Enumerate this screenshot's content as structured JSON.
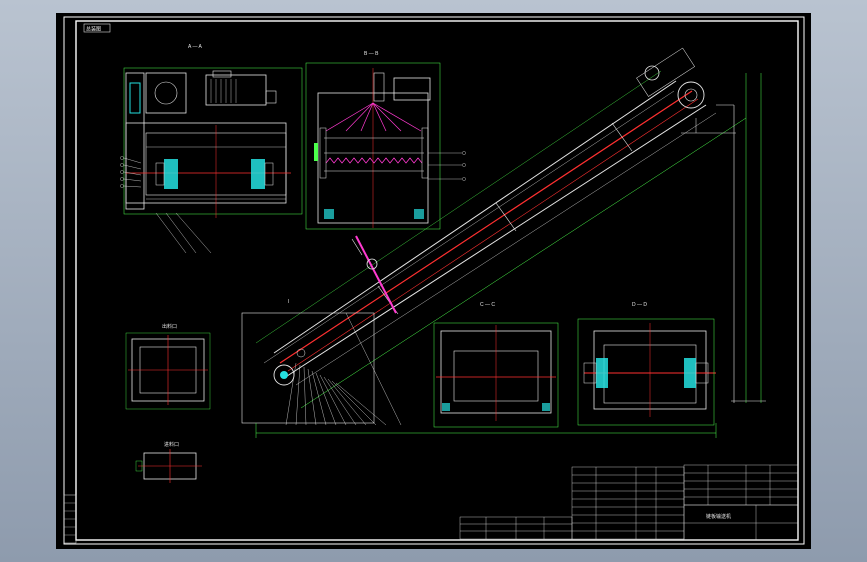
{
  "sheet": {
    "frame_color": "#ffffff",
    "line_color": "#e6e6e6",
    "center_line_color": "#ff3030",
    "dimension_color": "#4cff4c",
    "hatch_color": "#ff3ad0",
    "bearing_color": "#25e0e0"
  },
  "views": {
    "view_a": "A — A",
    "view_b": "B — B",
    "view_c": "C — C",
    "view_d": "D — D",
    "detail_top": "I",
    "detail_inlet": "出料口",
    "detail_small": "进料口"
  },
  "title_block": {
    "drawing_name": "链板输送机",
    "title_tag": "总装图"
  }
}
